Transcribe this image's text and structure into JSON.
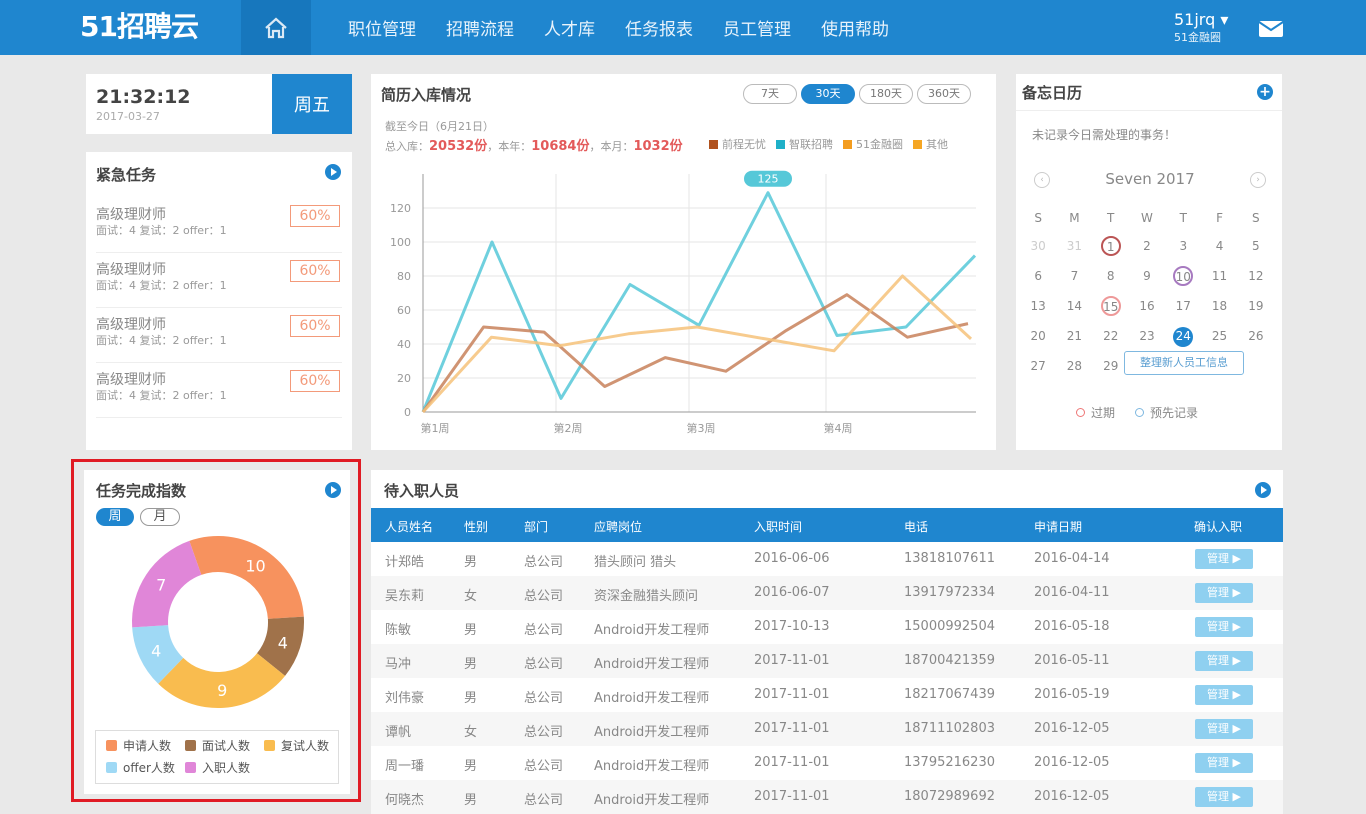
{
  "header": {
    "logo": "51招聘云",
    "nav": [
      "职位管理",
      "招聘流程",
      "人才库",
      "任务报表",
      "员工管理",
      "使用帮助"
    ],
    "user": "51jrq",
    "company": "51金融圈"
  },
  "clock": {
    "time": "21:32:12",
    "date": "2017-03-27",
    "weekday": "周五"
  },
  "urgent": {
    "title": "紧急任务",
    "tasks": [
      {
        "name": "高级理财师",
        "detail": "面试：4  复试：2  offer：1",
        "percent": "60%"
      },
      {
        "name": "高级理财师",
        "detail": "面试：4  复试：2  offer：1",
        "percent": "60%"
      },
      {
        "name": "高级理财师",
        "detail": "面试：4  复试：2  offer：1",
        "percent": "60%"
      },
      {
        "name": "高级理财师",
        "detail": "面试：4  复试：2  offer：1",
        "percent": "60%"
      }
    ]
  },
  "resume": {
    "title": "简历入库情况",
    "ranges": [
      "7天",
      "30天",
      "180天",
      "360天"
    ],
    "active_range": "30天",
    "as_of": "截至今日（6月21日）",
    "total_label": "总入库：",
    "total": "20532份",
    "year_label": "，本年：",
    "year": "10684份",
    "month_label": "，本月：",
    "month": "1032份",
    "legend": [
      {
        "name": "前程无忧",
        "color": "#b0521e"
      },
      {
        "name": "智联招聘",
        "color": "#1fb0c8"
      },
      {
        "name": "51金融圈",
        "color": "#f39c1f"
      },
      {
        "name": "其他",
        "color": "#f5a623"
      }
    ]
  },
  "chart_data": {
    "type": "line",
    "x_ticks": [
      "第1周",
      "第2周",
      "第3周",
      "第4周"
    ],
    "y_ticks": [
      0,
      20,
      40,
      60,
      80,
      100,
      120
    ],
    "ylim": [
      0,
      140
    ],
    "peak_label": "125",
    "series": [
      {
        "color": "#56c8d8",
        "values": [
          0,
          100,
          8,
          75,
          51,
          129,
          45,
          50,
          92
        ]
      },
      {
        "color": "#c8815a",
        "values": [
          0,
          50,
          47,
          15,
          32,
          24,
          48,
          69,
          44,
          52
        ]
      },
      {
        "color": "#f6c27a",
        "values": [
          0,
          44,
          39,
          46,
          50,
          43,
          36,
          80,
          43
        ]
      }
    ]
  },
  "memo": {
    "title": "备忘日历",
    "hint": "未记录今日需处理的事务！",
    "month": "Seven 2017",
    "weekdays": [
      "S",
      "M",
      "T",
      "W",
      "T",
      "F",
      "S"
    ],
    "weeks": [
      [
        "30",
        "31",
        "1",
        "2",
        "3",
        "4",
        "5"
      ],
      [
        "6",
        "7",
        "8",
        "9",
        "10",
        "11",
        "12"
      ],
      [
        "13",
        "14",
        "15",
        "16",
        "17",
        "18",
        "19"
      ],
      [
        "20",
        "21",
        "22",
        "23",
        "24",
        "25",
        "26"
      ],
      [
        "27",
        "28",
        "29",
        "",
        "",
        "",
        ""
      ]
    ],
    "event": "整理新人员工信息",
    "legend_overdue": "过期",
    "legend_record": "预先记录"
  },
  "completion": {
    "title": "任务完成指数",
    "tab_week": "周",
    "tab_month": "月",
    "segments": [
      {
        "label": "申请人数",
        "value": "10",
        "color": "#f7925e"
      },
      {
        "label": "面试人数",
        "value": "4",
        "color": "#a0724a"
      },
      {
        "label": "复试人数",
        "value": "9",
        "color": "#f9bc4f"
      },
      {
        "label": "offer人数",
        "value": "4",
        "color": "#9fd9f5"
      },
      {
        "label": "入职人数",
        "value": "7",
        "color": "#e086d8"
      }
    ]
  },
  "onboard": {
    "title": "待入职人员",
    "columns": [
      "人员姓名",
      "性别",
      "部门",
      "应聘岗位",
      "入职时间",
      "电话",
      "申请日期",
      "确认入职"
    ],
    "button": "管理 ▶",
    "rows": [
      [
        "计郑皓",
        "男",
        "总公司",
        "猎头顾问 猎头",
        "2016-06-06",
        "13818107611",
        "2016-04-14"
      ],
      [
        "吴东莉",
        "女",
        "总公司",
        "资深金融猎头顾问",
        "2016-06-07",
        "13917972334",
        "2016-04-11"
      ],
      [
        "陈敏",
        "男",
        "总公司",
        "Android开发工程师",
        "2017-10-13",
        "15000992504",
        "2016-05-18"
      ],
      [
        "马冲",
        "男",
        "总公司",
        "Android开发工程师",
        "2017-11-01",
        "18700421359",
        "2016-05-11"
      ],
      [
        "刘伟豪",
        "男",
        "总公司",
        "Android开发工程师",
        "2017-11-01",
        "18217067439",
        "2016-05-19"
      ],
      [
        "谭帆",
        "女",
        "总公司",
        "Android开发工程师",
        "2017-11-01",
        "18711102803",
        "2016-12-05"
      ],
      [
        "周一璠",
        "男",
        "总公司",
        "Android开发工程师",
        "2017-11-01",
        "13795216230",
        "2016-12-05"
      ],
      [
        "何晓杰",
        "男",
        "总公司",
        "Android开发工程师",
        "2017-11-01",
        "18072989692",
        "2016-12-05"
      ]
    ]
  }
}
